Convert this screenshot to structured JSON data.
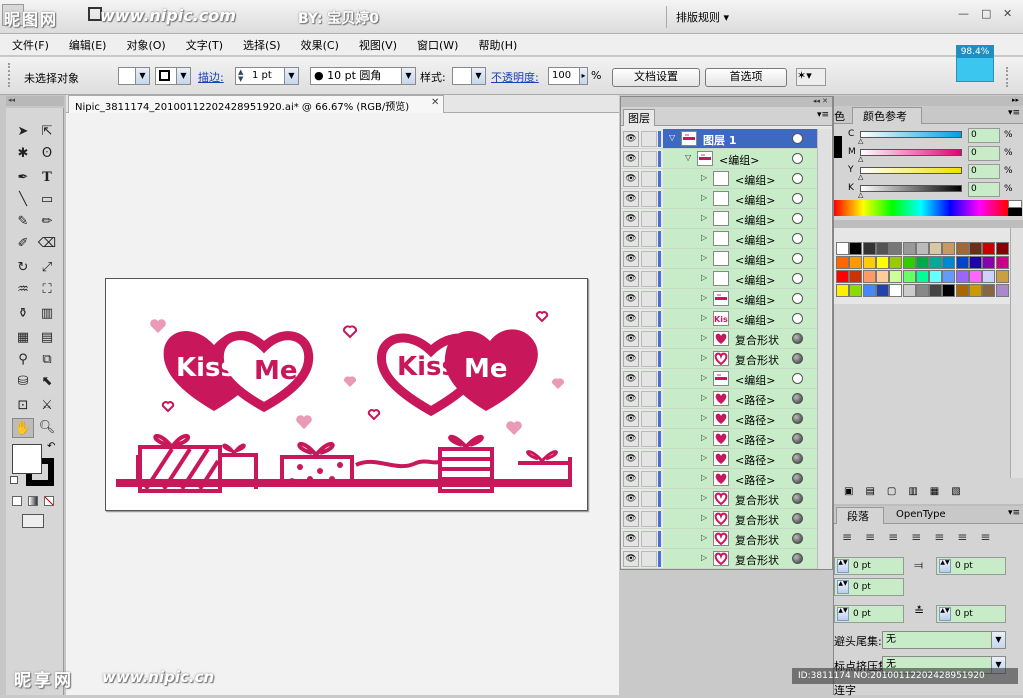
{
  "title": {
    "logo": "昵图网",
    "url": "www.nipic.com",
    "by": "BY: 宝贝婷0",
    "workspace": "排版规则 ▾",
    "minimize": "—",
    "restore": "□",
    "close": "✕"
  },
  "menu": [
    "文件(F)",
    "编辑(E)",
    "对象(O)",
    "文字(T)",
    "选择(S)",
    "效果(C)",
    "视图(V)",
    "窗口(W)",
    "帮助(H)"
  ],
  "control": {
    "no_selection": "未选择对象",
    "stroke_label": "描边:",
    "stroke_weight": "1 pt",
    "brush": "● 10 pt 圆角",
    "style_label": "样式:",
    "opacity_label": "不透明度:",
    "opacity_value": "100",
    "opacity_unit": "%",
    "doc_setup": "文档设置",
    "preferences": "首选项",
    "zoom_indicator": "98.4%"
  },
  "document": {
    "tab": "Nipic_3811174_20100112202428951920.ai* @ 66.67% (RGB/预览)",
    "close": "✕"
  },
  "artwork": {
    "text1": "Kiss",
    "text2": "Me",
    "text3": "Kiss",
    "text4": "Me",
    "accent": "#c8175a"
  },
  "layers": {
    "tab": "图层",
    "rows": [
      {
        "name": "图层 1",
        "indent": 0,
        "expanded": true,
        "target": "ring",
        "thumb": "art",
        "selected": true
      },
      {
        "name": "<编组>",
        "indent": 1,
        "expanded": true,
        "target": "ring",
        "thumb": "art"
      },
      {
        "name": "<编组>",
        "indent": 2,
        "expanded": false,
        "target": "ring",
        "thumb": "blank"
      },
      {
        "name": "<编组>",
        "indent": 2,
        "expanded": false,
        "target": "ring",
        "thumb": "blank"
      },
      {
        "name": "<编组>",
        "indent": 2,
        "expanded": false,
        "target": "ring",
        "thumb": "blank"
      },
      {
        "name": "<编组>",
        "indent": 2,
        "expanded": false,
        "target": "ring",
        "thumb": "blank"
      },
      {
        "name": "<编组>",
        "indent": 2,
        "expanded": false,
        "target": "ring",
        "thumb": "blank"
      },
      {
        "name": "<编组>",
        "indent": 2,
        "expanded": false,
        "target": "ring",
        "thumb": "blank"
      },
      {
        "name": "<编组>",
        "indent": 2,
        "expanded": false,
        "target": "ring",
        "thumb": "art"
      },
      {
        "name": "<编组>",
        "indent": 2,
        "expanded": false,
        "target": "ring",
        "thumb": "kiss"
      },
      {
        "name": "复合形状",
        "indent": 2,
        "expanded": false,
        "target": "filled",
        "thumb": "heart"
      },
      {
        "name": "复合形状",
        "indent": 2,
        "expanded": false,
        "target": "filled",
        "thumb": "heart-outline"
      },
      {
        "name": "<编组>",
        "indent": 2,
        "expanded": false,
        "target": "ring",
        "thumb": "art"
      },
      {
        "name": "<路径>",
        "indent": 2,
        "expanded": false,
        "target": "filled",
        "thumb": "heart"
      },
      {
        "name": "<路径>",
        "indent": 2,
        "expanded": false,
        "target": "filled",
        "thumb": "heart"
      },
      {
        "name": "<路径>",
        "indent": 2,
        "expanded": false,
        "target": "filled",
        "thumb": "heart"
      },
      {
        "name": "<路径>",
        "indent": 2,
        "expanded": false,
        "target": "filled",
        "thumb": "heart"
      },
      {
        "name": "<路径>",
        "indent": 2,
        "expanded": false,
        "target": "filled",
        "thumb": "heart"
      },
      {
        "name": "复合形状",
        "indent": 2,
        "expanded": false,
        "target": "filled",
        "thumb": "heart-outline"
      },
      {
        "name": "复合形状",
        "indent": 2,
        "expanded": false,
        "target": "filled",
        "thumb": "heart-outline"
      },
      {
        "name": "复合形状",
        "indent": 2,
        "expanded": false,
        "target": "filled",
        "thumb": "heart-outline"
      },
      {
        "name": "复合形状",
        "indent": 2,
        "expanded": false,
        "target": "filled",
        "thumb": "heart-outline"
      }
    ]
  },
  "color": {
    "tab_color": "色",
    "tab_guide": "颜色参考",
    "channels": [
      {
        "label": "C",
        "value": "0",
        "unit": "%",
        "gradient": "linear-gradient(to right,#fff,#00a0e0)"
      },
      {
        "label": "M",
        "value": "0",
        "unit": "%",
        "gradient": "linear-gradient(to right,#fff,#e0007a)"
      },
      {
        "label": "Y",
        "value": "0",
        "unit": "%",
        "gradient": "linear-gradient(to right,#fff,#f0e000)"
      },
      {
        "label": "K",
        "value": "0",
        "unit": "%",
        "gradient": "linear-gradient(to right,#fff,#000)"
      }
    ]
  },
  "paragraph": {
    "tab_paragraph": "段落",
    "tab_opentype": "OpenType",
    "left_indent": "0 pt",
    "right_indent": "0 pt",
    "first_line": "0 pt",
    "space_before": "0 pt",
    "space_after": "0 pt",
    "kinsoku_label": "避头尾集:",
    "kinsoku_value": "无",
    "mojikumi_label": "标点挤压集:",
    "mojikumi_value": "无",
    "hyphen": "连字"
  },
  "watermark": {
    "brand": "昵享网",
    "url": "www.nipic.cn",
    "id": "ID:3811174 NO:20100112202428951920"
  }
}
